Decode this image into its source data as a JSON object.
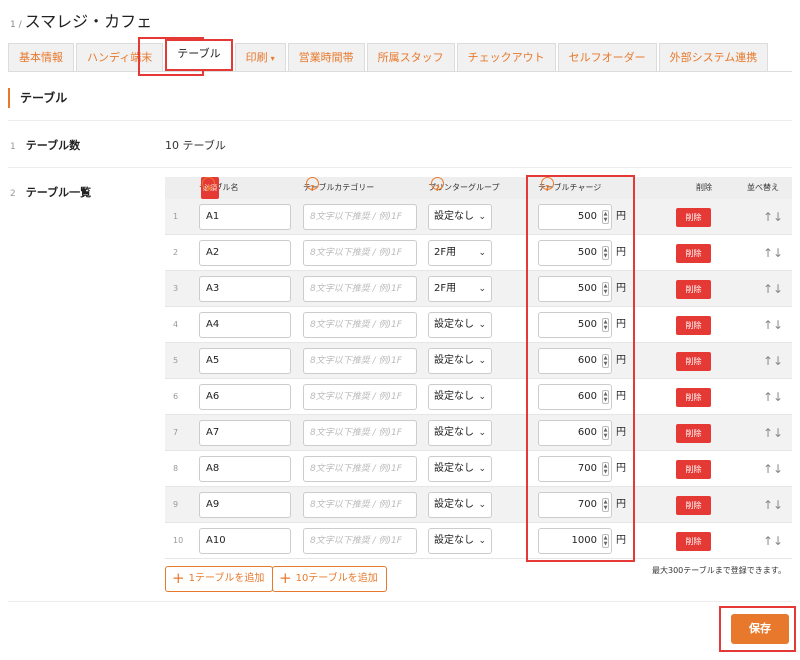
{
  "header": {
    "step": "1 /",
    "title": "スマレジ・カフェ"
  },
  "tabs": [
    {
      "label": "基本情報"
    },
    {
      "label": "ハンディ端末"
    },
    {
      "label": "テーブル"
    },
    {
      "label": "印刷",
      "caret": "▾"
    },
    {
      "label": "営業時間帯"
    },
    {
      "label": "所属スタッフ"
    },
    {
      "label": "チェックアウト"
    },
    {
      "label": "セルフオーダー"
    },
    {
      "label": "外部システム連携"
    }
  ],
  "section": {
    "title": "テーブル"
  },
  "rows": {
    "count": {
      "num": "1",
      "label": "テーブル数",
      "value": "10 テーブル"
    },
    "list": {
      "num": "2",
      "label": "テーブル一覧"
    }
  },
  "table": {
    "headers": {
      "name": "テーブル名",
      "required": "必須",
      "category": "テーブルカテゴリー",
      "printer": "プリンターグループ",
      "charge": "テーブルチャージ",
      "delete": "削除",
      "sort": "並べ替え"
    },
    "help_glyph": "?",
    "category_placeholder": "8文字以下推奨 / 例)1F",
    "yen": "円",
    "delete_label": "削除",
    "sort_glyph": "↑↓",
    "select_chevron": "⌄",
    "spin_up": "▲",
    "spin_down": "▼",
    "items": [
      {
        "idx": "1",
        "name": "A1",
        "printer": "設定なし",
        "charge": "500"
      },
      {
        "idx": "2",
        "name": "A2",
        "printer": "2F用",
        "charge": "500"
      },
      {
        "idx": "3",
        "name": "A3",
        "printer": "2F用",
        "charge": "500"
      },
      {
        "idx": "4",
        "name": "A4",
        "printer": "設定なし",
        "charge": "500"
      },
      {
        "idx": "5",
        "name": "A5",
        "printer": "設定なし",
        "charge": "600"
      },
      {
        "idx": "6",
        "name": "A6",
        "printer": "設定なし",
        "charge": "600"
      },
      {
        "idx": "7",
        "name": "A7",
        "printer": "設定なし",
        "charge": "600"
      },
      {
        "idx": "8",
        "name": "A8",
        "printer": "設定なし",
        "charge": "700"
      },
      {
        "idx": "9",
        "name": "A9",
        "printer": "設定なし",
        "charge": "700"
      },
      {
        "idx": "10",
        "name": "A10",
        "printer": "設定なし",
        "charge": "1000"
      }
    ]
  },
  "actions": {
    "plus": "+",
    "add_one": "1テーブルを追加",
    "add_ten": "10テーブルを追加",
    "limit_note": "最大300テーブルまで登録できます。",
    "save": "保存"
  },
  "colors": {
    "accent": "#e8792c",
    "danger": "#e53935",
    "highlight": "#e53935"
  }
}
